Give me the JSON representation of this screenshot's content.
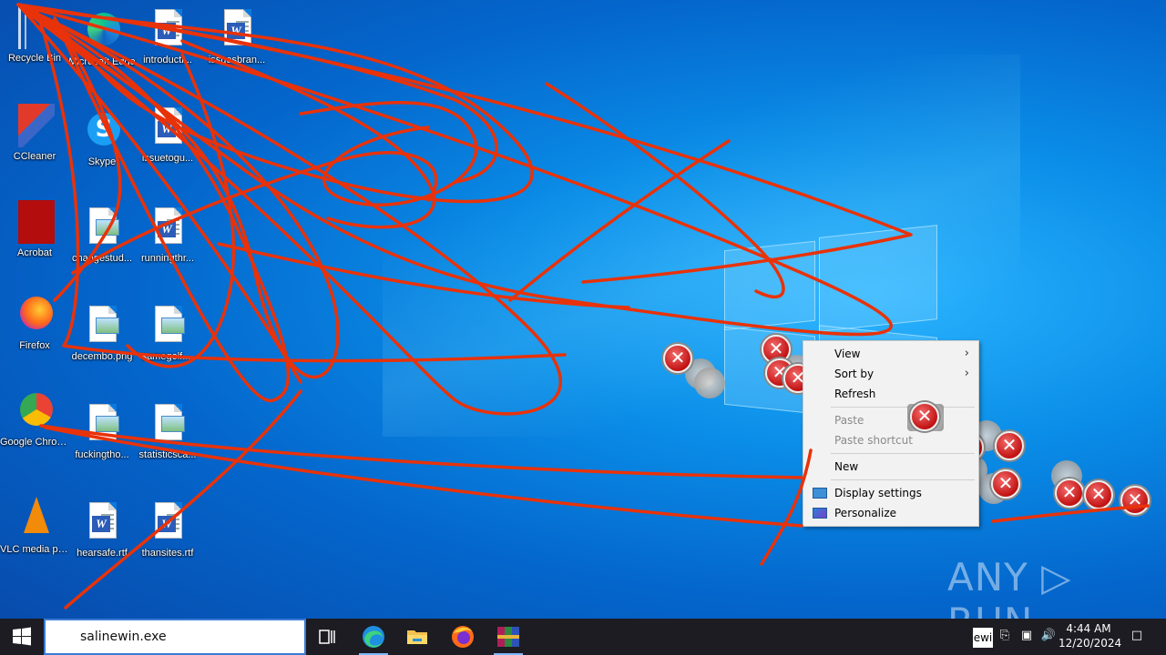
{
  "desktop": {
    "icons": [
      {
        "label": "Recycle Bin"
      },
      {
        "label": "Microsoft Edge"
      },
      {
        "label": "introducti..."
      },
      {
        "label": "issuesbran..."
      },
      {
        "label": "CCleaner"
      },
      {
        "label": "Skype"
      },
      {
        "label": "issuetogu..."
      },
      {
        "label": "Acrobat"
      },
      {
        "label": "changestud..."
      },
      {
        "label": "runningthr..."
      },
      {
        "label": "Firefox"
      },
      {
        "label": "decembo.png"
      },
      {
        "label": "samegolf...."
      },
      {
        "label": "Google Chrome"
      },
      {
        "label": "fuckingtho..."
      },
      {
        "label": "statisticsca..."
      },
      {
        "label": "VLC media player"
      },
      {
        "label": "hearsafe.rtf"
      },
      {
        "label": "thansites.rtf"
      }
    ]
  },
  "context_menu": {
    "items": [
      {
        "label": "View",
        "has_submenu": true,
        "enabled": true
      },
      {
        "label": "Sort by",
        "has_submenu": true,
        "enabled": true
      },
      {
        "label": "Refresh",
        "enabled": true
      },
      {
        "label": "Paste",
        "enabled": false
      },
      {
        "label": "Paste shortcut",
        "enabled": false
      },
      {
        "label": "New",
        "enabled": true
      },
      {
        "label": "Display settings",
        "icon": "display-icon",
        "enabled": true
      },
      {
        "label": "Personalize",
        "icon": "personalize-icon",
        "enabled": true
      }
    ]
  },
  "watermark": {
    "text": "ANY ▷ RUN"
  },
  "taskbar": {
    "search_text": "salinewin.exe",
    "apps": [
      "task-view-icon",
      "edge-icon",
      "file-explorer-icon",
      "firefox-icon",
      "winrar-icon"
    ],
    "tray": {
      "time": "4:44 AM",
      "date": "12/20/2024",
      "app_label": "ewi"
    }
  },
  "colors": {
    "scribble": "#e8320a",
    "taskbar": "#1c1c22",
    "error_red": "#c11212"
  }
}
